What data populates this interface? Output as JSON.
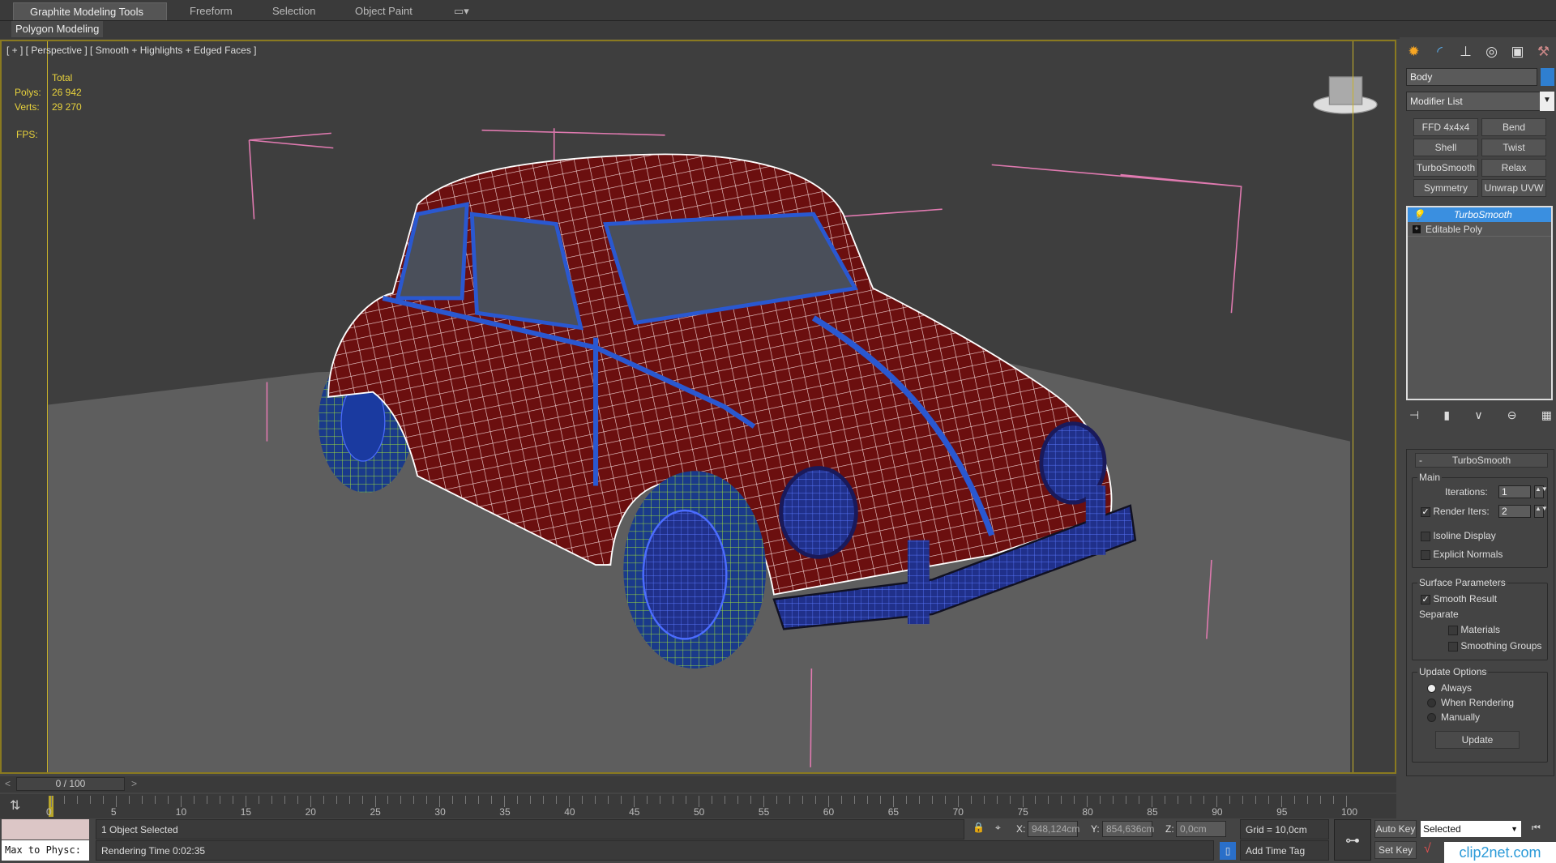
{
  "ribbon": {
    "tabs": [
      "Graphite Modeling Tools",
      "Freeform",
      "Selection",
      "Object Paint"
    ],
    "panel": "Polygon Modeling"
  },
  "viewport": {
    "label": "[ + ] [ Perspective ] [ Smooth + Highlights + Edged Faces ]",
    "stats": {
      "header": "Total",
      "polys_label": "Polys:",
      "polys": "26 942",
      "verts_label": "Verts:",
      "verts": "29 270",
      "fps_label": "FPS:"
    }
  },
  "command_panel": {
    "object_name": "Body",
    "object_color": "#2f7fd0",
    "modifier_list": "Modifier List",
    "modifier_buttons": [
      "FFD 4x4x4",
      "Bend",
      "Shell",
      "Twist",
      "TurboSmooth",
      "Relax",
      "Symmetry",
      "Unwrap UVW"
    ],
    "stack": [
      "TurboSmooth",
      "Editable Poly"
    ],
    "rollout": {
      "title": "TurboSmooth",
      "main": "Main",
      "iterations_label": "Iterations:",
      "iterations": "1",
      "render_iters_label": "Render Iters:",
      "render_iters": "2",
      "render_iters_checked": true,
      "isoline": "Isoline Display",
      "explicit_normals": "Explicit Normals",
      "surface": "Surface Parameters",
      "smooth_result": "Smooth Result",
      "separate": "Separate",
      "materials": "Materials",
      "smoothing_groups": "Smoothing Groups",
      "update_options": "Update Options",
      "always": "Always",
      "when_rendering": "When Rendering",
      "manually": "Manually",
      "update": "Update"
    }
  },
  "timeline": {
    "frame": "0 / 100",
    "prev": "<",
    "next": ">",
    "ticks": [
      "0",
      "5",
      "10",
      "15",
      "20",
      "25",
      "30",
      "35",
      "40",
      "45",
      "50",
      "55",
      "60",
      "65",
      "70",
      "75",
      "80",
      "85",
      "90",
      "95",
      "100"
    ]
  },
  "status": {
    "script": "Max to Physc:",
    "selection": "1 Object Selected",
    "render_time": "Rendering Time  0:02:35",
    "x_label": "X:",
    "x": "948,124cm",
    "y_label": "Y:",
    "y": "854,636cm",
    "z_label": "Z:",
    "z": "0,0cm",
    "grid": "Grid = 10,0cm",
    "add_time_tag": "Add Time Tag",
    "auto_key": "Auto Key",
    "set_key": "Set Key",
    "key_filter": "Selected",
    "watermark": "clip2net.com"
  }
}
